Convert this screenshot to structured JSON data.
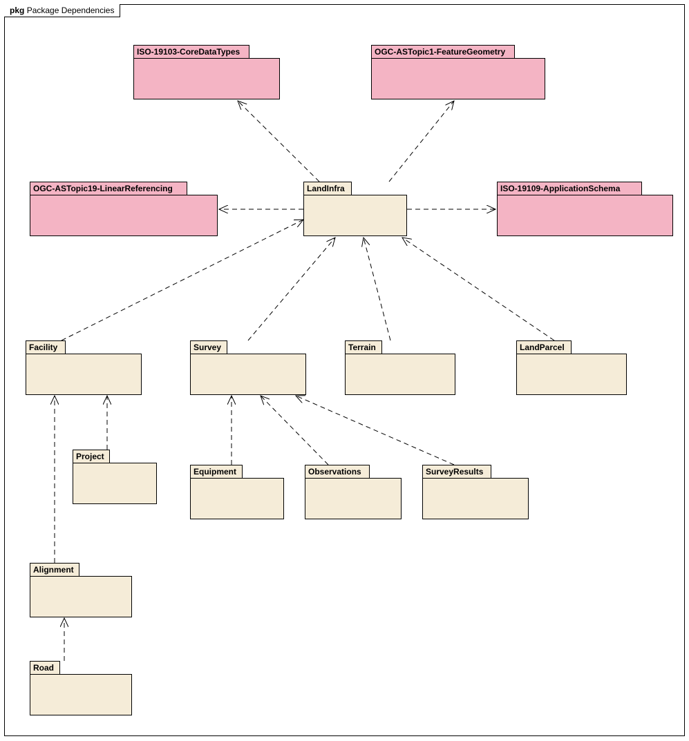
{
  "frame": {
    "prefix": "pkg",
    "title": "Package Dependencies"
  },
  "packages": {
    "iso19103": "ISO-19103-CoreDataTypes",
    "ogcTopic1": "OGC-ASTopic1-FeatureGeometry",
    "ogcTopic19": "OGC-ASTopic19-LinearReferencing",
    "landInfra": "LandInfra",
    "iso19109": "ISO-19109-ApplicationSchema",
    "facility": "Facility",
    "survey": "Survey",
    "terrain": "Terrain",
    "landParcel": "LandParcel",
    "project": "Project",
    "equipment": "Equipment",
    "observations": "Observations",
    "surveyResults": "SurveyResults",
    "alignment": "Alignment",
    "road": "Road"
  }
}
